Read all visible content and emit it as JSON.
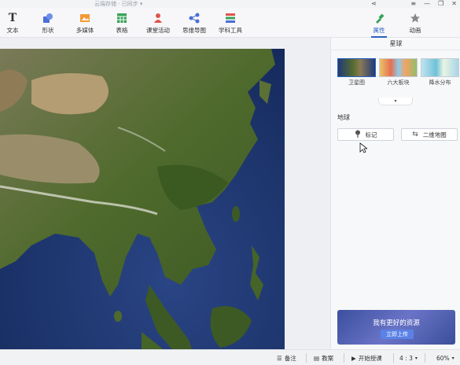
{
  "window": {
    "doc_title": "云端存储 · 已同步 ▾",
    "controls": [
      "≡",
      "—",
      "❐",
      "✕"
    ],
    "share_icon": "share-icon"
  },
  "toolbar": {
    "items": [
      {
        "label": "文本",
        "icon": "text-icon"
      },
      {
        "label": "形状",
        "icon": "shape-icon"
      },
      {
        "label": "多媒体",
        "icon": "media-icon"
      },
      {
        "label": "表格",
        "icon": "table-icon"
      },
      {
        "label": "课堂活动",
        "icon": "classroom-activity-icon"
      },
      {
        "label": "思维导图",
        "icon": "mindmap-icon"
      },
      {
        "label": "学科工具",
        "icon": "subject-tools-icon"
      }
    ]
  },
  "right_tabs": [
    {
      "label": "属性",
      "active": true
    },
    {
      "label": "动画",
      "active": false
    }
  ],
  "panel": {
    "title": "星球",
    "thumbnails": [
      {
        "caption": "卫星图",
        "selected": true
      },
      {
        "caption": "六大板块",
        "selected": false
      },
      {
        "caption": "降水分布",
        "selected": false
      }
    ],
    "collapse_glyph": "▾",
    "section_label": "地球",
    "buttons": {
      "mark": "标记",
      "map2d": "二维地图"
    },
    "banner": {
      "text": "我有更好的资源",
      "button": "立即上传"
    }
  },
  "canvas": {
    "zoom_in": "+",
    "zoom_out": "−"
  },
  "statusbar": {
    "notes": "备注",
    "teaching": "教案",
    "start": "开始授课",
    "ratio": "4 : 3",
    "zoom": "60%"
  },
  "colors": {
    "accent": "#2a62c4",
    "ocean": "#1a2f66",
    "land_green": "#4f6a2c",
    "desert": "#b49c73"
  }
}
